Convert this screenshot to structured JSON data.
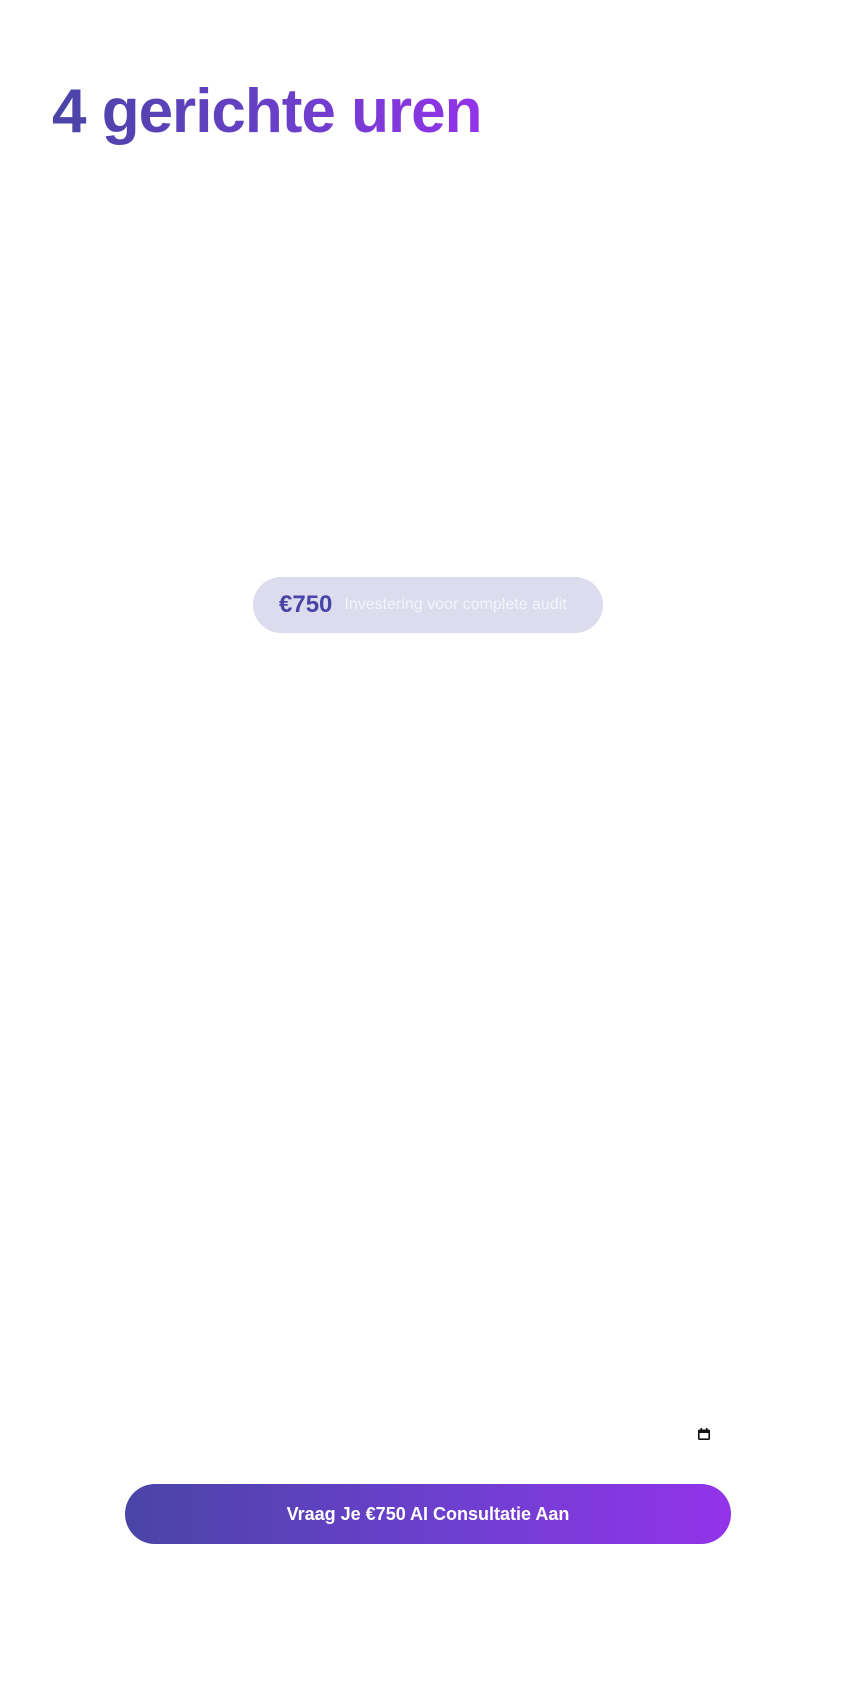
{
  "hero": {
    "title": "4 gerichte uren"
  },
  "pricing": {
    "amount": "€750",
    "caption": "Investering voor complete audit"
  },
  "cta": {
    "label": "Vraag Je €750 AI Consultatie Aan"
  },
  "icons": {
    "calendar": "calendar-icon"
  },
  "colors": {
    "gradient_start": "#4a44a6",
    "gradient_end": "#9333ea",
    "pill_background": "#dcdcee",
    "price_text": "#4a44a6"
  }
}
